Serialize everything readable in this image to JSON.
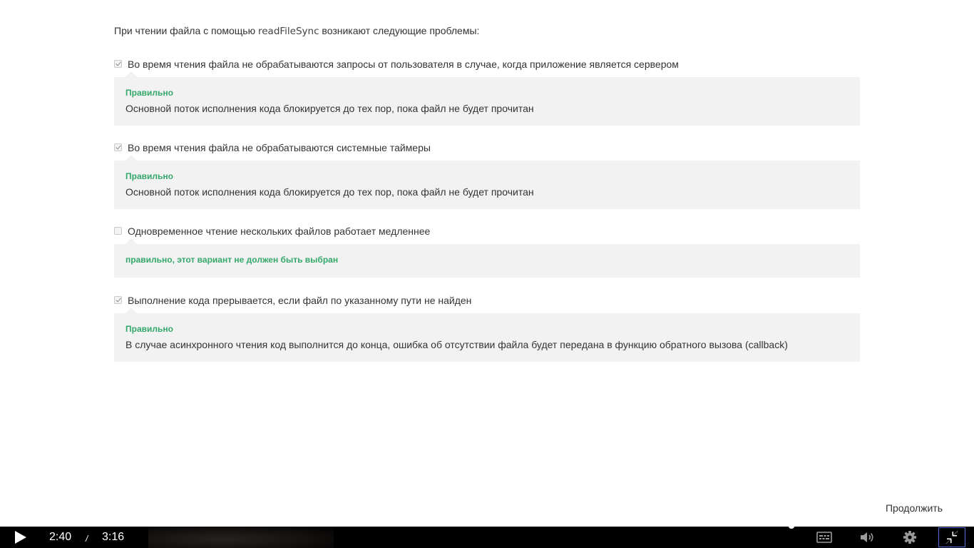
{
  "question": {
    "prefix": "При чтении файла с помощью ",
    "code": "readFileSync",
    "suffix": " возникают следующие проблемы:"
  },
  "options": [
    {
      "label": "Во время чтения файла не обрабатываются запросы от пользователя в случае, когда приложение является сервером",
      "checked": true,
      "verdict": "Правильно",
      "explanation": "Основной поток исполнения кода блокируется до тех пор, пока файл не будет прочитан"
    },
    {
      "label": "Во время чтения файла не обрабатываются системные таймеры",
      "checked": true,
      "verdict": "Правильно",
      "explanation": "Основной поток исполнения кода блокируется до тех пор, пока файл не будет прочитан"
    },
    {
      "label": "Одновременное чтение нескольких файлов работает медленнее",
      "checked": false,
      "verdict": "правильно, этот вариант не должен быть выбран",
      "explanation": ""
    },
    {
      "label": "Выполнение кода прерывается, если файл по указанному пути не найден",
      "checked": true,
      "verdict": "Правильно",
      "explanation": "В случае асинхронного чтения код выполнится до конца, ошибка об отсутствии файла будет передана в функцию обратного вызова (callback)"
    }
  ],
  "continue_label": "Продолжить",
  "player": {
    "current_time": "2:40",
    "separator": "/",
    "total_time": "3:16",
    "icons": {
      "play": "play-icon",
      "captions": "captions-icon",
      "volume": "volume-icon",
      "settings": "gear-icon",
      "fullscreen": "exit-fullscreen-icon"
    }
  },
  "colors": {
    "verdict": "#34a86a",
    "feedback_bg": "#f2f2f2",
    "player_bg": "#000000",
    "fullscreen_focus": "#4d6dd8"
  }
}
